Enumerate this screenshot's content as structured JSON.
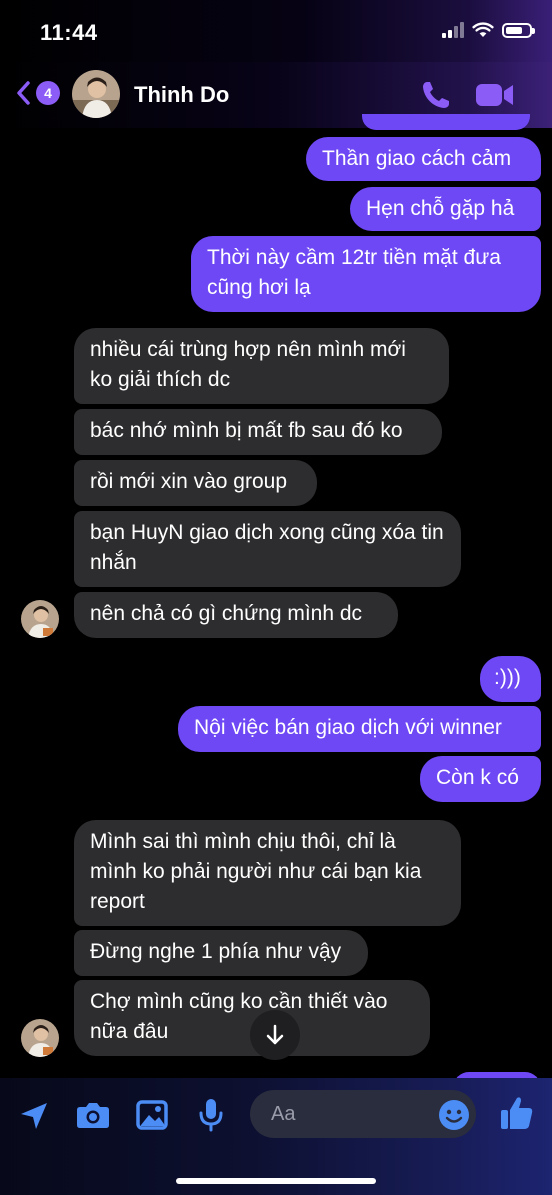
{
  "status_bar": {
    "time": "11:44"
  },
  "header": {
    "back_badge": "4",
    "contact_name": "Thinh Do"
  },
  "messages": [
    {
      "dir": "out",
      "text": "Thần giao cách cảm"
    },
    {
      "dir": "out",
      "text": "Hẹn chỗ gặp hả"
    },
    {
      "dir": "out",
      "text": "Thời này cầm 12tr tiền mặt đưa cũng hơi lạ"
    },
    {
      "dir": "in",
      "text": "nhiều cái trùng hợp nên mình mới ko giải thích dc"
    },
    {
      "dir": "in",
      "text": "bác nhớ mình bị mất fb sau đó ko"
    },
    {
      "dir": "in",
      "text": "rồi mới xin vào group"
    },
    {
      "dir": "in",
      "text": "bạn HuyN giao dịch xong cũng xóa tin nhắn"
    },
    {
      "dir": "in",
      "text": "nên chả có gì chứng mình dc"
    },
    {
      "dir": "out",
      "text": ":)))"
    },
    {
      "dir": "out",
      "text": "Nội việc bán giao dịch với winner"
    },
    {
      "dir": "out",
      "text": "Còn k có"
    },
    {
      "dir": "in",
      "text": "Mình sai thì mình chịu thôi, chỉ là mình ko phải người như cái bạn kia report"
    },
    {
      "dir": "in",
      "text": "Đừng nghe 1 phía như vậy"
    },
    {
      "dir": "in",
      "text": "Chợ mình cũng ko cần thiết vào nữa đâu"
    }
  ],
  "composer": {
    "placeholder": "Aa"
  },
  "icons": {
    "back": "chevron-left-icon",
    "call": "phone-icon",
    "video": "video-camera-icon",
    "location": "location-arrow-icon",
    "camera": "camera-icon",
    "gallery": "image-icon",
    "mic": "microphone-icon",
    "emoji": "smiley-icon",
    "like": "thumbs-up-icon",
    "scroll": "arrow-down-icon"
  },
  "colors": {
    "accent": "#8b5cf6",
    "outgoing_bubble": "#6e48f5",
    "incoming_bubble": "#2d2d2f",
    "composer_icon": "#4b8cf5"
  }
}
